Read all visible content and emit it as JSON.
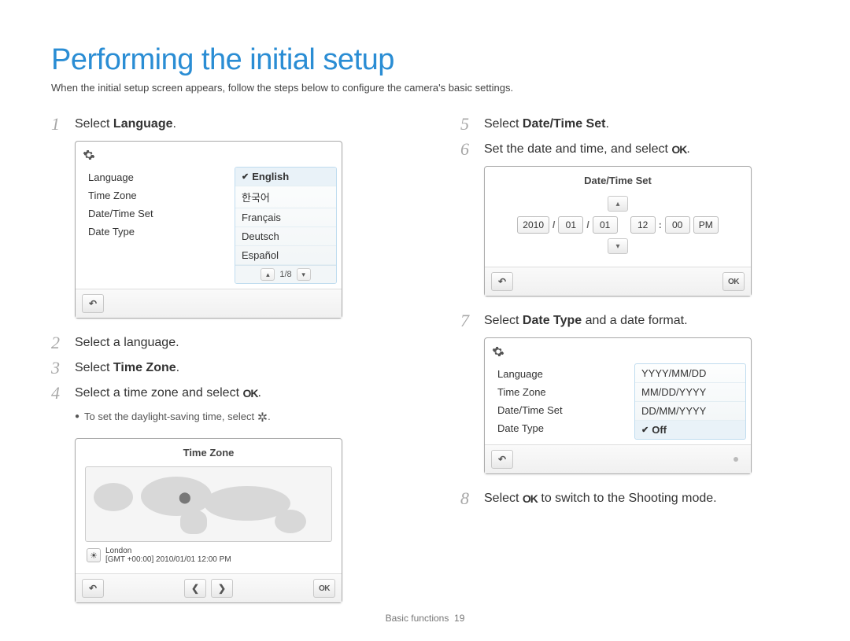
{
  "title": "Performing the initial setup",
  "intro": "When the initial setup screen appears, follow the steps below to configure the camera's basic settings.",
  "ok_glyph": "OK",
  "dst_glyph": "✲",
  "footer": {
    "section": "Basic functions",
    "page": "19"
  },
  "steps": {
    "s1": {
      "num": "1",
      "pre": "Select ",
      "bold": "Language",
      "post": "."
    },
    "s2": {
      "num": "2",
      "text": "Select a language."
    },
    "s3": {
      "num": "3",
      "pre": "Select ",
      "bold": "Time Zone",
      "post": "."
    },
    "s4": {
      "num": "4",
      "pre": "Select a time zone and select ",
      "post": ".",
      "bullet": "To set the daylight-saving time, select "
    },
    "s5": {
      "num": "5",
      "pre": "Select ",
      "bold": "Date/Time Set",
      "post": "."
    },
    "s6": {
      "num": "6",
      "pre": "Set the date and time, and select ",
      "post": "."
    },
    "s7": {
      "num": "7",
      "pre": "Select ",
      "bold": "Date Type",
      "post": " and a date format."
    },
    "s8": {
      "num": "8",
      "pre": "Select ",
      "post": " to switch to the Shooting mode."
    }
  },
  "screen_lang": {
    "left": [
      "Language",
      "Time Zone",
      "Date/Time Set",
      "Date Type"
    ],
    "options": [
      "English",
      "한국어",
      "Français",
      "Deutsch",
      "Español"
    ],
    "pager": "1/8"
  },
  "screen_tz": {
    "title": "Time Zone",
    "city": "London",
    "detail": "[GMT +00:00]  2010/01/01  12:00 PM"
  },
  "screen_dt": {
    "title": "Date/Time Set",
    "year": "2010",
    "month": "01",
    "day": "01",
    "hour": "12",
    "minute": "00",
    "ampm": "PM"
  },
  "screen_type": {
    "left": [
      "Language",
      "Time Zone",
      "Date/Time Set",
      "Date Type"
    ],
    "options": [
      "YYYY/MM/DD",
      "MM/DD/YYYY",
      "DD/MM/YYYY",
      "Off"
    ]
  }
}
